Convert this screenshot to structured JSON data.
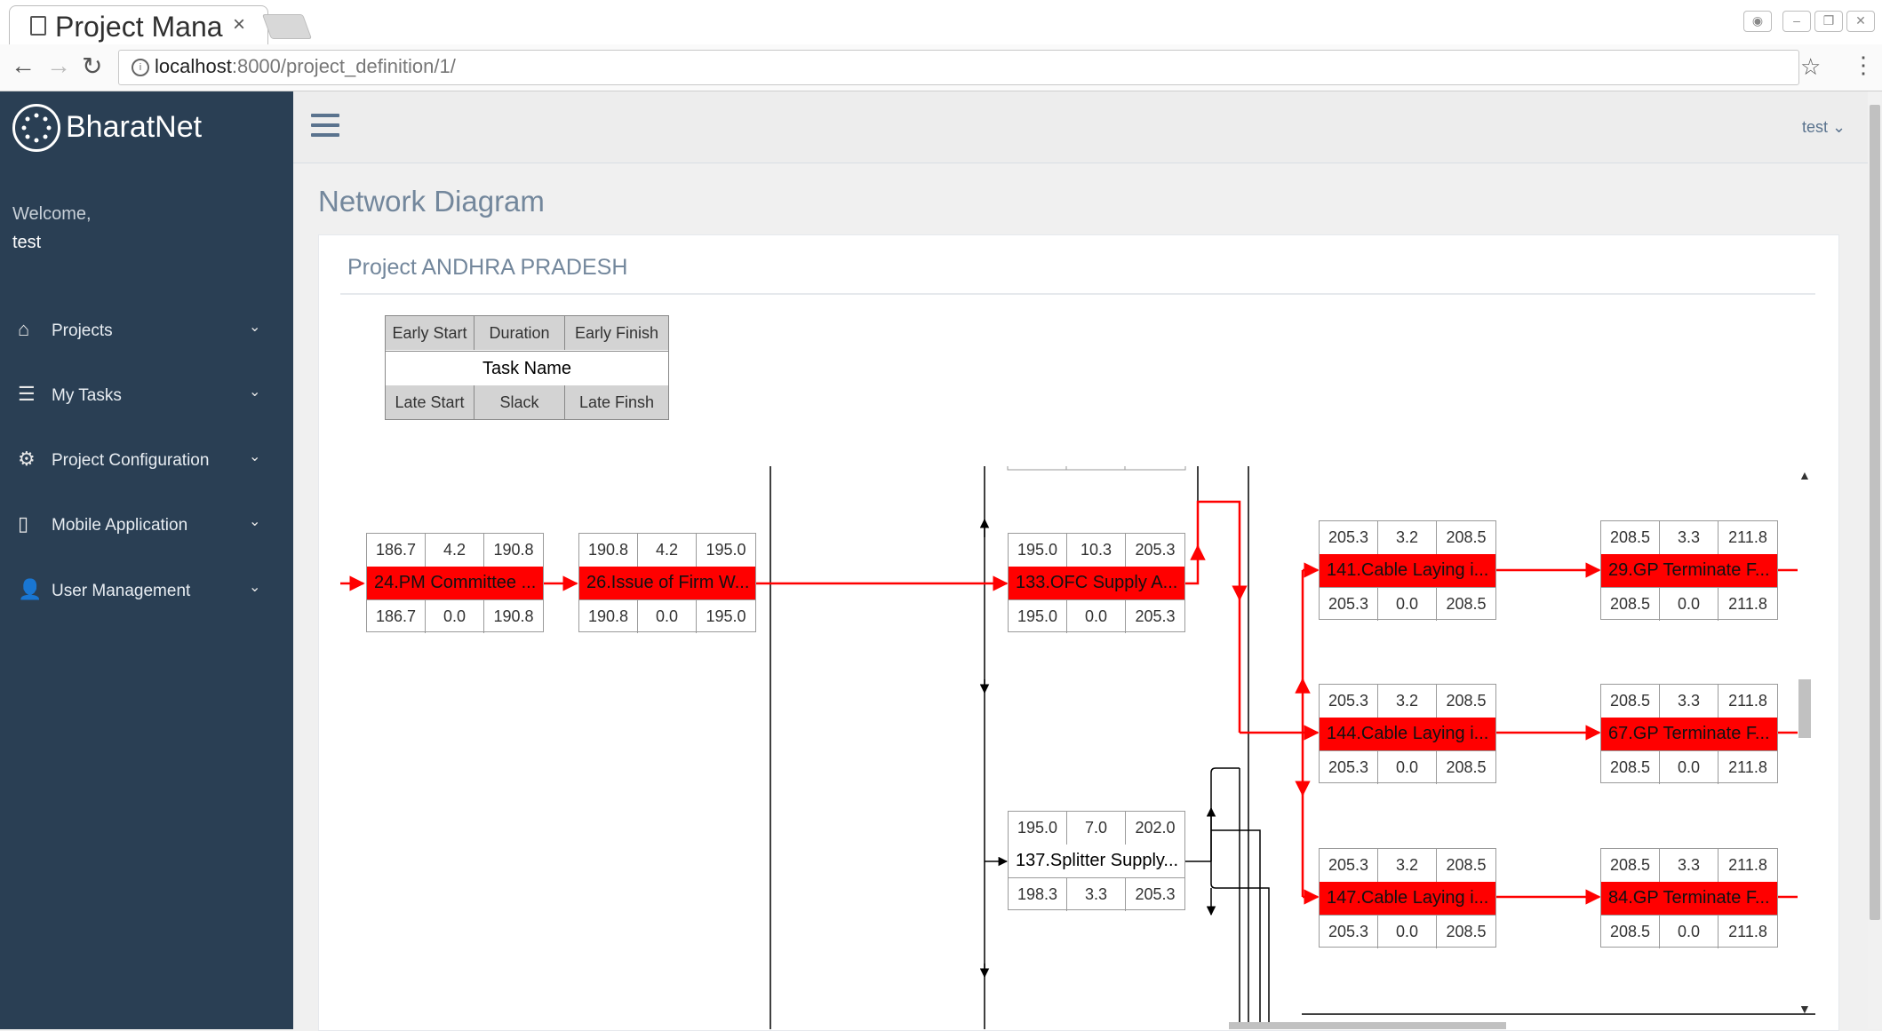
{
  "browser": {
    "tab_title": "Project Mana",
    "tab_close": "×",
    "url_host": "localhost",
    "url_rest": ":8000/project_definition/1/",
    "back": "←",
    "forward": "→",
    "reload": "↻",
    "star": "☆",
    "menu": "⋮",
    "info": "i"
  },
  "sidebar": {
    "brand": "BharatNet",
    "welcome": "Welcome,",
    "username": "test",
    "items": [
      {
        "label": "Projects",
        "icon": "home-icon",
        "glyph": "⌂"
      },
      {
        "label": "My Tasks",
        "icon": "tasks-icon",
        "glyph": "☰"
      },
      {
        "label": "Project Configuration",
        "icon": "gears-icon",
        "glyph": "⚙"
      },
      {
        "label": "Mobile Application",
        "icon": "mobile-icon",
        "glyph": "▯"
      },
      {
        "label": "User Management",
        "icon": "user-icon",
        "glyph": "👤"
      }
    ],
    "chevron": "⌄"
  },
  "topnav": {
    "user": "test ⌄"
  },
  "page": {
    "title": "Network Diagram",
    "panel_title": "Project ANDHRA PRADESH"
  },
  "legend": {
    "early_start": "Early Start",
    "duration": "Duration",
    "early_finish": "Early Finish",
    "task_name": "Task Name",
    "late_start": "Late Start",
    "slack": "Slack",
    "late_finish": "Late Finsh"
  },
  "nodes": [
    {
      "id": "n24",
      "critical": true,
      "name": "24.PM Committee ...",
      "es": "186.7",
      "dur": "4.2",
      "ef": "190.8",
      "ls": "186.7",
      "slack": "0.0",
      "lf": "190.8"
    },
    {
      "id": "n26",
      "critical": true,
      "name": "26.Issue of Firm W...",
      "es": "190.8",
      "dur": "4.2",
      "ef": "195.0",
      "ls": "190.8",
      "slack": "0.0",
      "lf": "195.0"
    },
    {
      "id": "n133",
      "critical": true,
      "name": "133.OFC Supply A...",
      "es": "195.0",
      "dur": "10.3",
      "ef": "205.3",
      "ls": "195.0",
      "slack": "0.0",
      "lf": "205.3"
    },
    {
      "id": "n137",
      "critical": false,
      "name": "137.Splitter Supply...",
      "es": "195.0",
      "dur": "7.0",
      "ef": "202.0",
      "ls": "198.3",
      "slack": "3.3",
      "lf": "205.3"
    },
    {
      "id": "n141",
      "critical": true,
      "name": "141.Cable Laying i...",
      "es": "205.3",
      "dur": "3.2",
      "ef": "208.5",
      "ls": "205.3",
      "slack": "0.0",
      "lf": "208.5"
    },
    {
      "id": "n144",
      "critical": true,
      "name": "144.Cable Laying i...",
      "es": "205.3",
      "dur": "3.2",
      "ef": "208.5",
      "ls": "205.3",
      "slack": "0.0",
      "lf": "208.5"
    },
    {
      "id": "n147",
      "critical": true,
      "name": "147.Cable Laying i...",
      "es": "205.3",
      "dur": "3.2",
      "ef": "208.5",
      "ls": "205.3",
      "slack": "0.0",
      "lf": "208.5"
    },
    {
      "id": "n29",
      "critical": true,
      "name": "29.GP Terminate F...",
      "es": "208.5",
      "dur": "3.3",
      "ef": "211.8",
      "ls": "208.5",
      "slack": "0.0",
      "lf": "211.8"
    },
    {
      "id": "n67",
      "critical": true,
      "name": "67.GP Terminate F...",
      "es": "208.5",
      "dur": "3.3",
      "ef": "211.8",
      "ls": "208.5",
      "slack": "0.0",
      "lf": "211.8"
    },
    {
      "id": "n84",
      "critical": true,
      "name": "84.GP Terminate F...",
      "es": "208.5",
      "dur": "3.3",
      "ef": "211.8",
      "ls": "208.5",
      "slack": "0.0",
      "lf": "211.8"
    }
  ],
  "colors": {
    "sidebar_bg": "#2a3f54",
    "critical": "#ff0000",
    "heading": "#73879c"
  }
}
